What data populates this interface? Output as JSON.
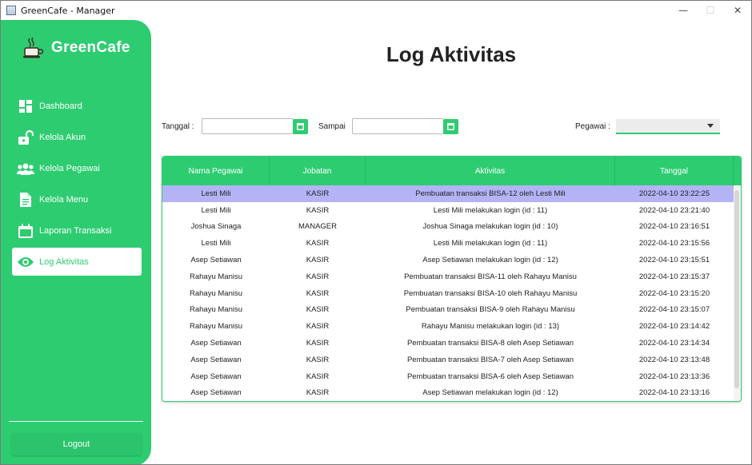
{
  "window": {
    "title": "GreenCafe - Manager",
    "minimize": "—",
    "maximize": "☐",
    "close": "✕"
  },
  "brand": {
    "name": "GreenCafe"
  },
  "colors": {
    "primary": "#2ecc71",
    "selected_row": "#b3b3f6"
  },
  "sidebar": {
    "items": [
      {
        "label": "Dashboard",
        "icon": "dashboard-icon"
      },
      {
        "label": "Kelola Akun",
        "icon": "unlock-icon"
      },
      {
        "label": "Kelola Pegawai",
        "icon": "users-icon"
      },
      {
        "label": "Kelola Menu",
        "icon": "document-icon"
      },
      {
        "label": "Laporan Transaksi",
        "icon": "calendar-icon"
      },
      {
        "label": "Log Aktivitas",
        "icon": "eye-icon",
        "active": true
      }
    ],
    "logout_label": "Logout"
  },
  "page": {
    "title": "Log Aktivitas"
  },
  "filters": {
    "tanggal_label": "Tanggal :",
    "tanggal_value": "",
    "sampai_label": "Sampai",
    "sampai_value": "",
    "pegawai_label": "Pegawai :",
    "pegawai_value": ""
  },
  "table": {
    "columns": [
      "Nama Pegawai",
      "Jobatan",
      "Aktivitas",
      "Tanggal"
    ],
    "rows": [
      [
        "Lesti Mili",
        "KASIR",
        "Pembuatan transaksi BISA-12 oleh Lesti Mili",
        "2022-04-10 23:22:25"
      ],
      [
        "Lesti Mili",
        "KASIR",
        "Lesti Mili melakukan login (id : 11)",
        "2022-04-10 23:21:40"
      ],
      [
        "Joshua Sinaga",
        "MANAGER",
        "Joshua Sinaga melakukan login (id : 10)",
        "2022-04-10 23:16:51"
      ],
      [
        "Lesti Mili",
        "KASIR",
        "Lesti Mili melakukan login (id : 11)",
        "2022-04-10 23:15:56"
      ],
      [
        "Asep Setiawan",
        "KASIR",
        "Asep Setiawan melakukan login (id : 12)",
        "2022-04-10 23:15:51"
      ],
      [
        "Rahayu Manisu",
        "KASIR",
        "Pembuatan transaksi BISA-11 oleh Rahayu Manisu",
        "2022-04-10 23:15:37"
      ],
      [
        "Rahayu Manisu",
        "KASIR",
        "Pembuatan transaksi BISA-10 oleh Rahayu Manisu",
        "2022-04-10 23:15:20"
      ],
      [
        "Rahayu Manisu",
        "KASIR",
        "Pembuatan transaksi BISA-9 oleh Rahayu Manisu",
        "2022-04-10 23:15:07"
      ],
      [
        "Rahayu Manisu",
        "KASIR",
        "Rahayu Manisu melakukan login (id : 13)",
        "2022-04-10 23:14:42"
      ],
      [
        "Asep Setiawan",
        "KASIR",
        "Pembuatan transaksi BISA-8 oleh Asep Setiawan",
        "2022-04-10 23:14:34"
      ],
      [
        "Asep Setiawan",
        "KASIR",
        "Pembuatan transaksi BISA-7 oleh Asep Setiawan",
        "2022-04-10 23:13:48"
      ],
      [
        "Asep Setiawan",
        "KASIR",
        "Pembuatan transaksi BISA-6 oleh Asep Setiawan",
        "2022-04-10 23:13:36"
      ],
      [
        "Asep Setiawan",
        "KASIR",
        "Asep Setiawan melakukan login (id : 12)",
        "2022-04-10 23:13:16"
      ]
    ],
    "selected_row": 0
  }
}
